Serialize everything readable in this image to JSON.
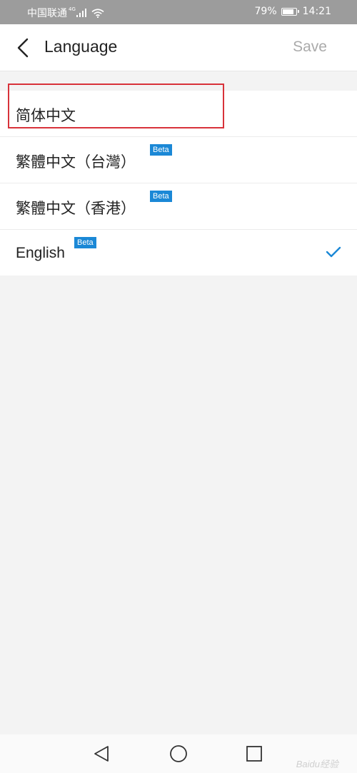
{
  "status_bar": {
    "carrier": "中国联通",
    "network_type": "4G",
    "battery_percent": "79%",
    "time": "14:21",
    "icons": [
      "signal-icon",
      "wifi-icon",
      "battery-icon"
    ]
  },
  "header": {
    "back_icon": "chevron-left-icon",
    "title": "Language",
    "save_label": "Save"
  },
  "languages": [
    {
      "label": "简体中文",
      "beta": false,
      "selected": false,
      "highlighted": true
    },
    {
      "label": "繁體中文（台灣）",
      "beta": true,
      "badge": "Beta",
      "selected": false
    },
    {
      "label": "繁體中文（香港）",
      "beta": true,
      "badge": "Beta",
      "selected": false
    },
    {
      "label": "English",
      "beta": true,
      "badge": "Beta",
      "selected": true
    }
  ],
  "nav_bar": {
    "icons": [
      "nav-back-icon",
      "nav-home-icon",
      "nav-recent-icon"
    ]
  },
  "watermark": "Baidu经验",
  "colors": {
    "status_bar": "#9c9c9c",
    "accent": "#1b88d6",
    "highlight_border": "#d8323a",
    "save_disabled": "#aaaaaa",
    "background": "#f3f3f3"
  }
}
